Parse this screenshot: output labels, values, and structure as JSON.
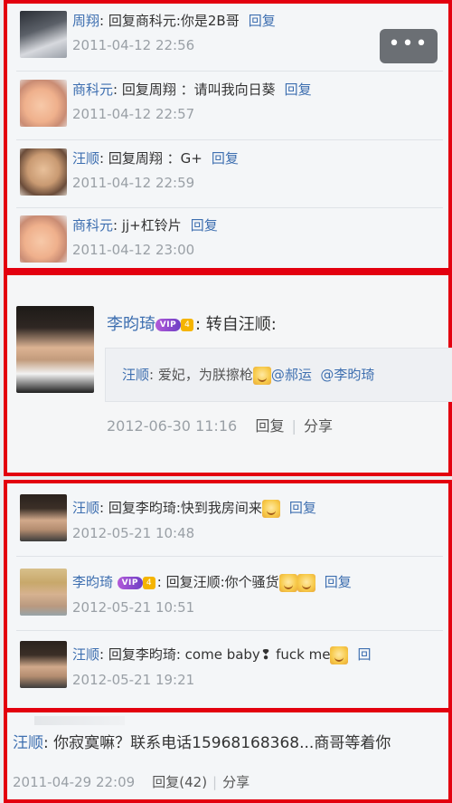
{
  "more_button": {
    "label": "•••"
  },
  "panel1": {
    "comments": [
      {
        "name": "周翔",
        "text": ": 回复商科元:你是2B哥",
        "reply": "回复",
        "time": "2011-04-12 22:56",
        "avatar": "dark-portrait"
      },
      {
        "name": "商科元",
        "text": ": 回复周翔 ：请叫我向日葵",
        "reply": "回复",
        "time": "2011-04-12 22:57",
        "avatar": "baby-face"
      },
      {
        "name": "汪顺",
        "text": ": 回复周翔 ：G+",
        "reply": "回复",
        "time": "2011-04-12 22:59",
        "avatar": "boy-face"
      },
      {
        "name": "商科元",
        "text": ": jj+杠铃片",
        "reply": "回复",
        "time": "2011-04-12 23:00",
        "avatar": "baby-face"
      }
    ]
  },
  "panel2": {
    "author": "李昀琦",
    "vip_badge": "VIP",
    "vip_level": "4",
    "title_suffix": ": 转自汪顺:",
    "quote_name": "汪顺",
    "quote_text": ": 爱妃，为朕擦枪",
    "quote_mention_1": "@郝运",
    "quote_mention_2": "@李昀琦",
    "time": "2012-06-30 11:16",
    "reply_label": "回复",
    "share_label": "分享"
  },
  "panel3": {
    "comments": [
      {
        "name": "汪顺",
        "text": ": 回复李昀琦:快到我房间来",
        "emoji_count": 1,
        "reply": "回复",
        "time": "2012-05-21 10:48",
        "avatar": "man-face"
      },
      {
        "name": "李昀琦",
        "vip": true,
        "text": ": 回复汪顺:你个骚货",
        "emoji_count": 2,
        "reply": "回复",
        "time": "2012-05-21 10:51",
        "avatar": "blond-face"
      },
      {
        "name": "汪顺",
        "text": ": 回复李昀琦: come baby❢ fuck me",
        "emoji_count": 1,
        "reply": "回",
        "time": "2012-05-21 19:21",
        "avatar": "man-face"
      }
    ]
  },
  "panel4": {
    "name": "汪顺",
    "text": ": 你寂寞嘛？联系电话15968168368...商哥等着你",
    "time": "2011-04-29 22:09",
    "reply_label": "回复(42)",
    "share_label": "分享"
  },
  "colors": {
    "frame": "#e3000f",
    "link": "#3e6fb0",
    "meta": "#9aa0a6"
  }
}
